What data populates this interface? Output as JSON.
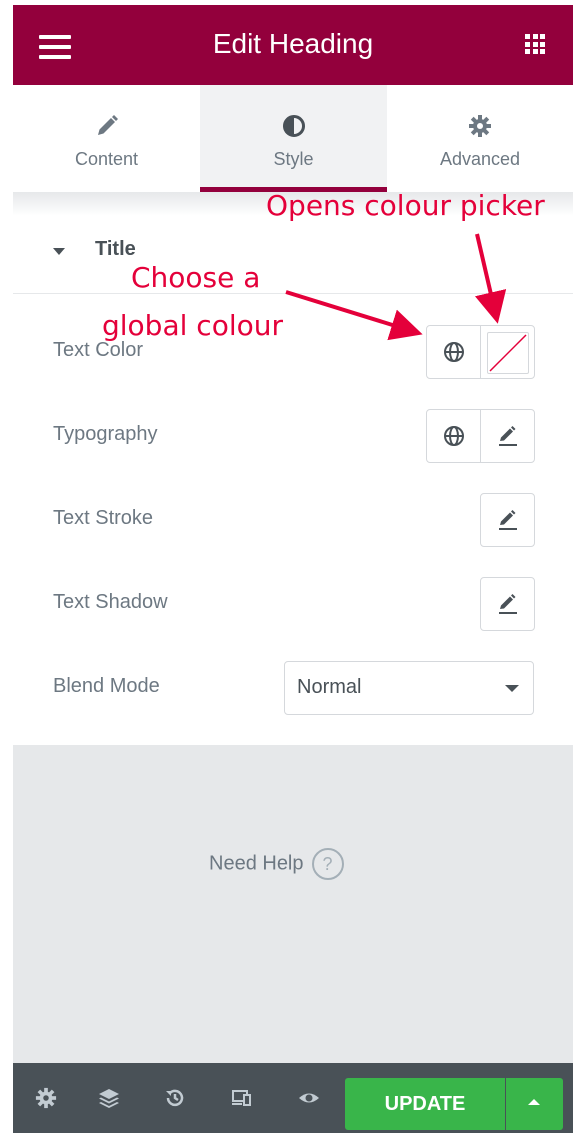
{
  "header": {
    "title": "Edit Heading",
    "menu_icon": "hamburger-icon",
    "apps_icon": "grid-icon"
  },
  "tabs": [
    {
      "label": "Content",
      "icon": "pencil-icon",
      "active": false
    },
    {
      "label": "Style",
      "icon": "half-circle-icon",
      "active": true
    },
    {
      "label": "Advanced",
      "icon": "gear-icon",
      "active": false
    }
  ],
  "section": {
    "title": "Title"
  },
  "controls": {
    "text_color": "Text Color",
    "typography": "Typography",
    "text_stroke": "Text Stroke",
    "text_shadow": "Text Shadow",
    "blend_mode": "Blend Mode",
    "blend_mode_value": "Normal"
  },
  "help": {
    "label": "Need Help",
    "icon_glyph": "?"
  },
  "footer": {
    "update_label": "UPDATE"
  },
  "annotations": {
    "colour_picker": "Opens colour picker",
    "global_line1": "Choose a",
    "global_line2": "global colour"
  },
  "colors": {
    "brand": "#93003c",
    "update": "#39b54a",
    "annotation": "#e4003a",
    "footer": "#495157"
  }
}
